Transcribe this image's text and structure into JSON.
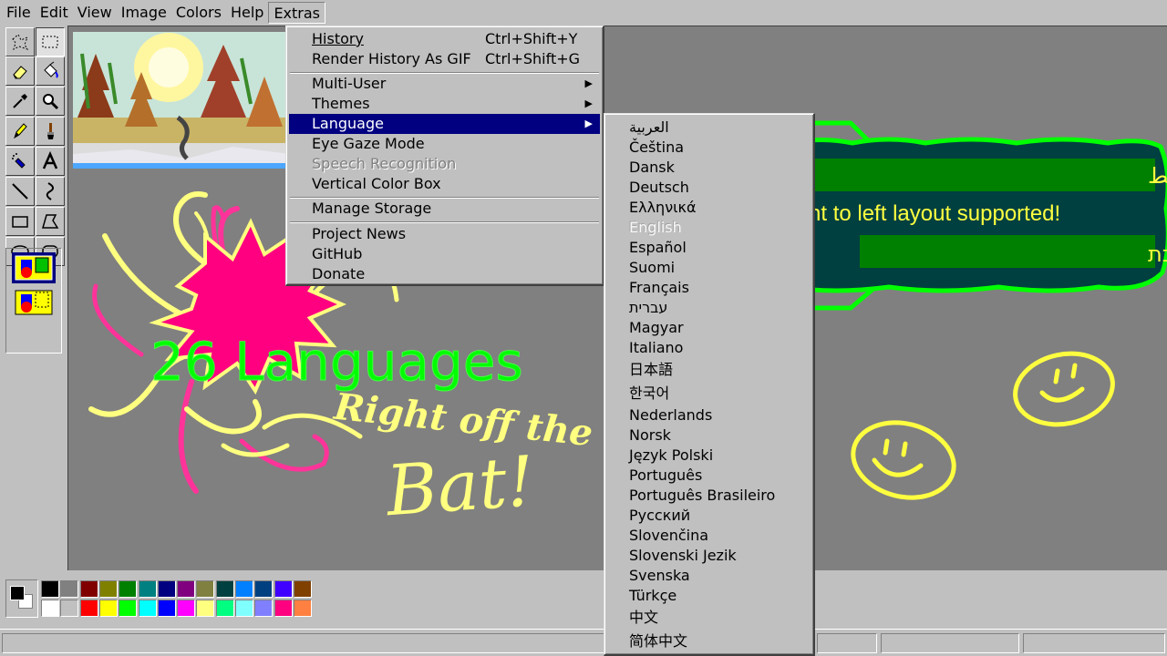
{
  "menubar": {
    "file": "File",
    "edit": "Edit",
    "view": "View",
    "image": "Image",
    "colors": "Colors",
    "help": "Help",
    "extras": "Extras"
  },
  "extras_menu": {
    "history": "History",
    "history_shortcut": "Ctrl+Shift+Y",
    "render_gif": "Render History As GIF",
    "render_gif_shortcut": "Ctrl+Shift+G",
    "multi_user": "Multi-User",
    "themes": "Themes",
    "language": "Language",
    "eye_gaze": "Eye Gaze Mode",
    "speech": "Speech Recognition",
    "vertical_color_box": "Vertical Color Box",
    "manage_storage": "Manage Storage",
    "project_news": "Project News",
    "github": "GitHub",
    "donate": "Donate"
  },
  "languages": [
    "العربية",
    "Čeština",
    "Dansk",
    "Deutsch",
    "Ελληνικά",
    "English",
    "Español",
    "Suomi",
    "Français",
    "עברית",
    "Magyar",
    "Italiano",
    "日本語",
    "한국어",
    "Nederlands",
    "Norsk",
    "Język Polski",
    "Português",
    "Português Brasileiro",
    "Русский",
    "Slovenčina",
    "Slovenski Jezik",
    "Svenska",
    "Türkçe",
    "中文",
    "简体中文"
  ],
  "callout": {
    "arabic": "دعم من اليمين إلى اليسار التخطيط",
    "english": "Right to left layout supported!",
    "hebrew": "פריסה מימין לשמאל נתמכת"
  },
  "canvas_art": {
    "headline": "26 Languages",
    "tagline_1": "Right off the",
    "tagline_2": "Bat!"
  },
  "palette": {
    "foreground": "#000000",
    "background": "#ffffff",
    "row1": [
      "#000000",
      "#808080",
      "#800000",
      "#808000",
      "#008000",
      "#008080",
      "#000080",
      "#800080",
      "#808040",
      "#004040",
      "#0080ff",
      "#004080",
      "#4000ff",
      "#804000"
    ],
    "row2": [
      "#ffffff",
      "#c0c0c0",
      "#ff0000",
      "#ffff00",
      "#00ff00",
      "#00ffff",
      "#0000ff",
      "#ff00ff",
      "#ffff80",
      "#00ff80",
      "#80ffff",
      "#8080ff",
      "#ff0080",
      "#ff8040"
    ]
  }
}
